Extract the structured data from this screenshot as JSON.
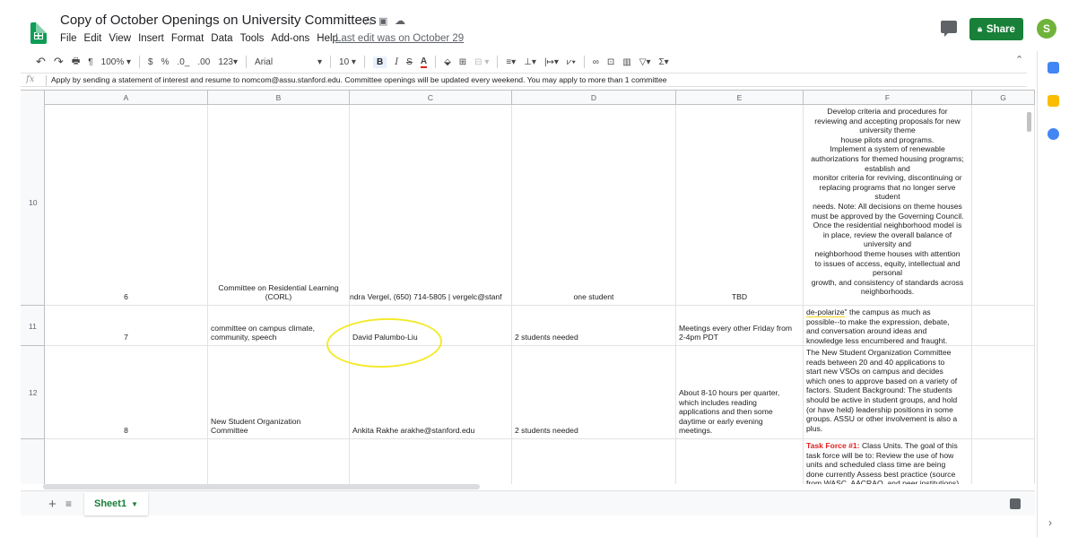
{
  "header": {
    "doc_title": "Copy of  October Openings on University Committees",
    "menu": [
      "File",
      "Edit",
      "View",
      "Insert",
      "Format",
      "Data",
      "Tools",
      "Add-ons",
      "Help"
    ],
    "last_edit": "Last edit was on October 29",
    "share_label": "Share",
    "avatar_letter": "S"
  },
  "toolbar": {
    "zoom": "100%",
    "currency": "$",
    "percent": "%",
    "dec_dec": ".0_",
    "inc_dec": ".00",
    "format": "123",
    "font": "Arial",
    "size": "10",
    "bold": "B",
    "italic": "I",
    "strike": "S",
    "color": "A"
  },
  "formula_bar": {
    "fx": "fx",
    "content": "Apply by sending a statement of interest and resume to nomcom@assu.stanford.edu. Committee openings will be updated every weekend. You may apply to more than 1 committee"
  },
  "columns": [
    "A",
    "B",
    "C",
    "D",
    "E",
    "F",
    "G"
  ],
  "rows": [
    {
      "num": "10",
      "a": "6",
      "b": "Committee on Residential Learning (CORL)",
      "c": "ndra Vergel, (650) 714-5805 | vergelc@stanf",
      "d": "one student",
      "e": "TBD",
      "f_lines": [
        "Develop criteria and procedures for",
        "reviewing and accepting proposals for new",
        "university theme",
        "house pilots and programs.",
        "Implement a system of renewable",
        "authorizations for themed housing programs;",
        "establish and",
        "monitor criteria for reviving, discontinuing or",
        "replacing programs that no longer serve",
        "student",
        "needs. Note: All decisions on theme houses",
        "must be approved by the Governing Council.",
        "Once the residential neighborhood model is",
        "in place, review the overall balance of",
        "university and",
        "neighborhood theme houses with attention",
        "to issues of access, equity, intellectual and",
        "personal",
        "growth, and consistency of standards across",
        "neighborhoods."
      ]
    },
    {
      "num": "11",
      "a": "7",
      "b_lines": [
        "committee on campus climate,",
        "community, speech"
      ],
      "c": "David Palumbo-Liu",
      "d": "2 students needed",
      "e_lines": [
        "Meetings every other Friday from",
        "2-4pm PDT"
      ],
      "f_lines": [
        "de-polarize\" the campus as much as",
        "possible--to make the expression, debate,",
        "and conversation around ideas and",
        "knowledge less encumbered and fraught."
      ]
    },
    {
      "num": "12",
      "a": "8",
      "b_lines": [
        "New Student Organization",
        "Committee"
      ],
      "c": "Ankita Rakhe arakhe@stanford.edu",
      "d": "2 students needed",
      "e_lines": [
        "About 8-10 hours per quarter,",
        "which includes reading",
        "applications and then some",
        "daytime or early evening",
        "meetings."
      ],
      "f_lines": [
        "The New Student Organization Committee",
        "reads between 20 and 40 applications to",
        "start new VSOs on campus and decides",
        "which ones to approve based on a variety of",
        "factors. Student Background: The students",
        "should be active in student groups, and hold",
        "(or have held) leadership positions in some",
        "groups. ASSU or other involvement is also a",
        "plus."
      ]
    },
    {
      "num": "",
      "f_red": "Task Force #1:",
      "f_lines": [
        " Class Units. The goal of this",
        "task force will be to: Review the use of how",
        "units and scheduled class time are being",
        "done currently Assess best practice (source",
        "from WASC, AACRAO, and peer institutions)"
      ]
    }
  ],
  "sheet_tab": "Sheet1"
}
